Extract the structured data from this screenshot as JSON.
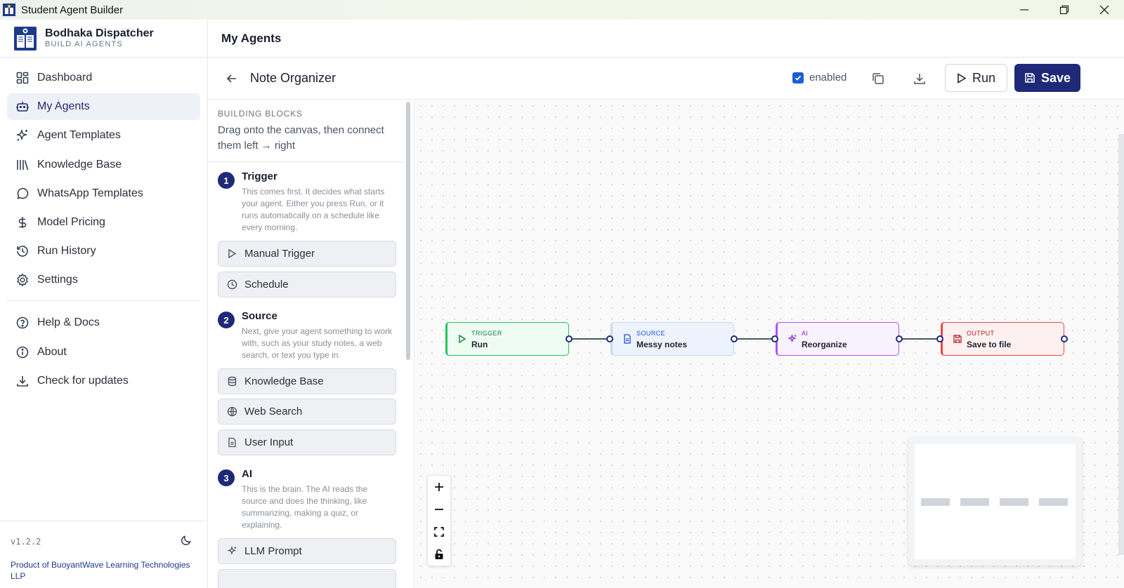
{
  "window": {
    "title": "Student Agent Builder"
  },
  "brand": {
    "name": "Bodhaka Dispatcher",
    "tagline": "BUILD AI AGENTS"
  },
  "nav": {
    "items": [
      {
        "label": "Dashboard",
        "icon": "dashboard-icon"
      },
      {
        "label": "My Agents",
        "icon": "bot-icon",
        "active": true
      },
      {
        "label": "Agent Templates",
        "icon": "sparkles-icon"
      },
      {
        "label": "Knowledge Base",
        "icon": "library-icon"
      },
      {
        "label": "WhatsApp Templates",
        "icon": "message-circle-icon"
      },
      {
        "label": "Model Pricing",
        "icon": "dollar-icon"
      },
      {
        "label": "Run History",
        "icon": "history-icon"
      },
      {
        "label": "Settings",
        "icon": "gear-icon"
      }
    ],
    "secondary": [
      {
        "label": "Help & Docs",
        "icon": "help-circle-icon"
      },
      {
        "label": "About",
        "icon": "info-icon"
      },
      {
        "label": "Check for updates",
        "icon": "download-icon"
      }
    ]
  },
  "footer": {
    "version": "v1.2.2",
    "product": "Product of BuoyantWave Learning Technologies LLP"
  },
  "header": {
    "title": "My Agents"
  },
  "agent": {
    "name": "Note Organizer",
    "enabled_label": "enabled",
    "enabled": true,
    "run_label": "Run",
    "save_label": "Save"
  },
  "blocks": {
    "caption": "BUILDING BLOCKS",
    "hint": "Drag onto the canvas, then connect them left → right",
    "steps": [
      {
        "num": "1",
        "title": "Trigger",
        "desc": "This comes first. It decides what starts your agent. Either you press Run, or it runs automatically on a schedule like every morning.",
        "items": [
          {
            "label": "Manual Trigger",
            "icon": "play-icon"
          },
          {
            "label": "Schedule",
            "icon": "clock-icon"
          }
        ]
      },
      {
        "num": "2",
        "title": "Source",
        "desc": "Next, give your agent something to work with, such as your study notes, a web search, or text you type in.",
        "items": [
          {
            "label": "Knowledge Base",
            "icon": "database-icon"
          },
          {
            "label": "Web Search",
            "icon": "globe-icon"
          },
          {
            "label": "User Input",
            "icon": "file-text-icon"
          }
        ]
      },
      {
        "num": "3",
        "title": "AI",
        "desc": "This is the brain. The AI reads the source and does the thinking, like summarizing, making a quiz, or explaining.",
        "items": [
          {
            "label": "LLM Prompt",
            "icon": "sparkles-icon"
          }
        ]
      }
    ]
  },
  "flow": {
    "nodes": [
      {
        "kind": "TRIGGER",
        "label": "Run",
        "color": "#22c55e",
        "bg": "#effcf3",
        "kindColor": "#15803d",
        "icon": "play-icon"
      },
      {
        "kind": "SOURCE",
        "label": "Messy notes",
        "color": "#c7d7f5",
        "bg": "#edf3fd",
        "kindColor": "#1d4ed8",
        "icon": "file-text-icon"
      },
      {
        "kind": "AI",
        "label": "Reorganize",
        "color": "#a855f7",
        "bg": "#f8f1fe",
        "kindColor": "#7e22ce",
        "icon": "sparkles-icon"
      },
      {
        "kind": "OUTPUT",
        "label": "Save to file",
        "color": "#ef4444",
        "bg": "#fdf0f0",
        "kindColor": "#b91c1c",
        "icon": "save-icon"
      }
    ]
  },
  "colors": {
    "accent": "#1e2a78",
    "active_bg": "#eef1f8",
    "checkbox": "#1d5ed8"
  }
}
